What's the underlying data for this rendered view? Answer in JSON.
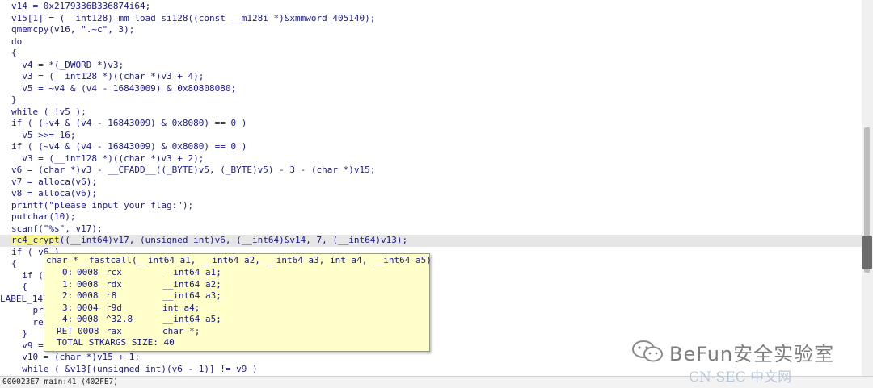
{
  "code_lines": [
    "v14 = 0x2179336B336874i64;",
    "v15[1] = (__int128)_mm_load_si128((const __m128i *)&xmmword_405140);",
    "qmemcpy(v16, \".~c\", 3);",
    "do",
    "{",
    "  v4 = *(_DWORD *)v3;",
    "  v3 = (__int128 *)((char *)v3 + 4);",
    "  v5 = ~v4 & (v4 - 16843009) & 0x80808080;",
    "}",
    "while ( !v5 );",
    "if ( (~v4 & (v4 - 16843009) & 0x8080) == 0 )",
    "  v5 >>= 16;",
    "if ( (~v4 & (v4 - 16843009) & 0x8080) == 0 )",
    "  v3 = (__int128 *)((char *)v3 + 2);",
    "v6 = (char *)v3 - __CFADD__((_BYTE)v5, (_BYTE)v5) - 3 - (char *)v15;",
    "v7 = alloca(v6);",
    "v8 = alloca(v6);",
    "printf(\"please input your flag:\");",
    "putchar(10);",
    "scanf(\"%s\", v17);",
    "rc4_crypt((__int64)v17, (unsigned int)v6, (__int64)&v14, 7, (__int64)v13);",
    "if ( v6 )",
    "{",
    "  if (",
    "  {",
    "LABEL_14:",
    "    pri",
    "    ret",
    "  }",
    "  v9 = ",
    "  v10 = (char *)v15 + 1;",
    "  while ( &v13[(unsigned int)(v6 - 1)] != v9 )"
  ],
  "cursor_token": "rc4_crypt",
  "tooltip": {
    "signature": "char *__fastcall(__int64 a1, __int64 a2, __int64 a3, int a4, __int64 a5)",
    "rows": [
      {
        "idx": "0:",
        "offset": "0008",
        "loc": "rcx",
        "decl": "__int64 a1;"
      },
      {
        "idx": "1:",
        "offset": "0008",
        "loc": "rdx",
        "decl": "__int64 a2;"
      },
      {
        "idx": "2:",
        "offset": "0008",
        "loc": "r8",
        "decl": "__int64 a3;"
      },
      {
        "idx": "3:",
        "offset": "0004",
        "loc": "r9d",
        "decl": "int a4;"
      },
      {
        "idx": "4:",
        "offset": "0008",
        "loc": "^32.8",
        "decl": "__int64 a5;"
      },
      {
        "idx": "RET",
        "offset": "0008",
        "loc": "rax",
        "decl": "char *;"
      }
    ],
    "total": "TOTAL STKARGS SIZE: 40"
  },
  "status": {
    "text": "000023E7 main:41 (402FE7)"
  },
  "watermark": {
    "text": "BeFun安全实验室",
    "sub": "CN-SEC 中文网"
  },
  "colors": {
    "code_text": "#1a1a8c",
    "highlight_line": "#e6e6e6",
    "cursor_token": "#f5f58a",
    "tooltip_bg": "#ffffcc"
  }
}
